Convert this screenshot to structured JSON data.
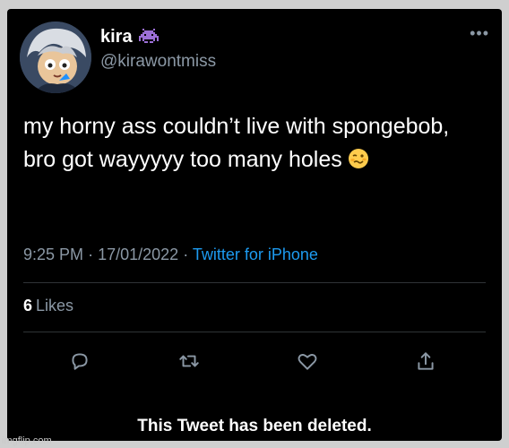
{
  "tweet": {
    "author": {
      "display_name": "kira",
      "handle": "@kirawontmiss",
      "badge_icon": "alien-monster-icon",
      "avatar_icon": "cartoon-avatar"
    },
    "more_icon": "ellipsis-icon",
    "text": "my horny ass couldn’t live with spongebob, bro got wayyyyy too many holes",
    "emoji_icon": "woozy-face-icon",
    "time": "9:25 PM",
    "date": "17/01/2022",
    "separator": "·",
    "source": "Twitter for iPhone",
    "likes": {
      "count": "6",
      "label": "Likes"
    },
    "actions": [
      "reply-icon",
      "retweet-icon",
      "like-icon",
      "share-icon"
    ],
    "deleted_notice": "This Tweet has been deleted."
  },
  "watermark": "imgflip.com",
  "colors": {
    "background": "#000000",
    "primary_text": "#ffffff",
    "secondary_text": "#8b98a5",
    "link": "#1d9bf0",
    "divider": "#2f3336",
    "badge": "#9b6fd6"
  }
}
